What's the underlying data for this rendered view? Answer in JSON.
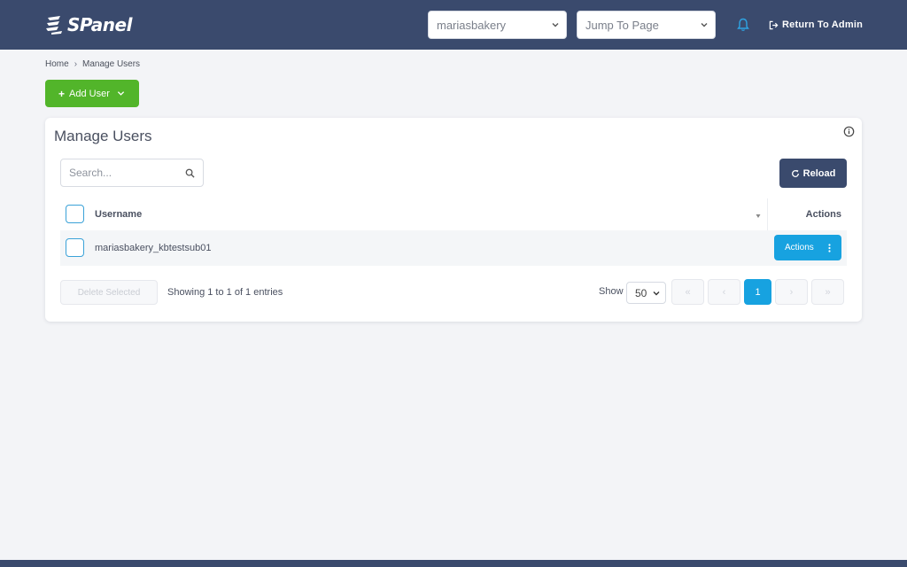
{
  "header": {
    "logo_text": "SPanel",
    "account_select": {
      "value": "mariasbakery"
    },
    "jump_select": {
      "value": "Jump To Page"
    },
    "return_admin_label": "Return To Admin"
  },
  "breadcrumb": {
    "home": "Home",
    "current": "Manage Users"
  },
  "add_user_label": "Add User",
  "card": {
    "title": "Manage Users",
    "search_placeholder": "Search...",
    "reload_label": "Reload",
    "table": {
      "columns": [
        "Username",
        "Actions"
      ],
      "rows": [
        {
          "username": "mariasbakery_kbtestsub01",
          "action_label": "Actions"
        }
      ]
    },
    "delete_selected_label": "Delete Selected",
    "showing_text": "Showing 1 to 1 of 1 entries",
    "show_label": "Show",
    "per_page_value": "50",
    "pagination": {
      "first": "«",
      "prev": "‹",
      "current_page": "1",
      "next": "›",
      "last": "»"
    }
  },
  "colors": {
    "topbar": "#3a4a6d",
    "add_user_green": "#52b52a",
    "accent_blue": "#17a2e0",
    "bell_blue": "#2ea3e3"
  },
  "icons": {
    "logo": "spanel-logo-icon",
    "bell": "bell-icon",
    "return": "sign-out-icon",
    "search": "search-icon",
    "reload": "refresh-icon",
    "info": "info-icon",
    "caret": "chevron-down-icon",
    "dots": "vertical-dots-icon"
  }
}
